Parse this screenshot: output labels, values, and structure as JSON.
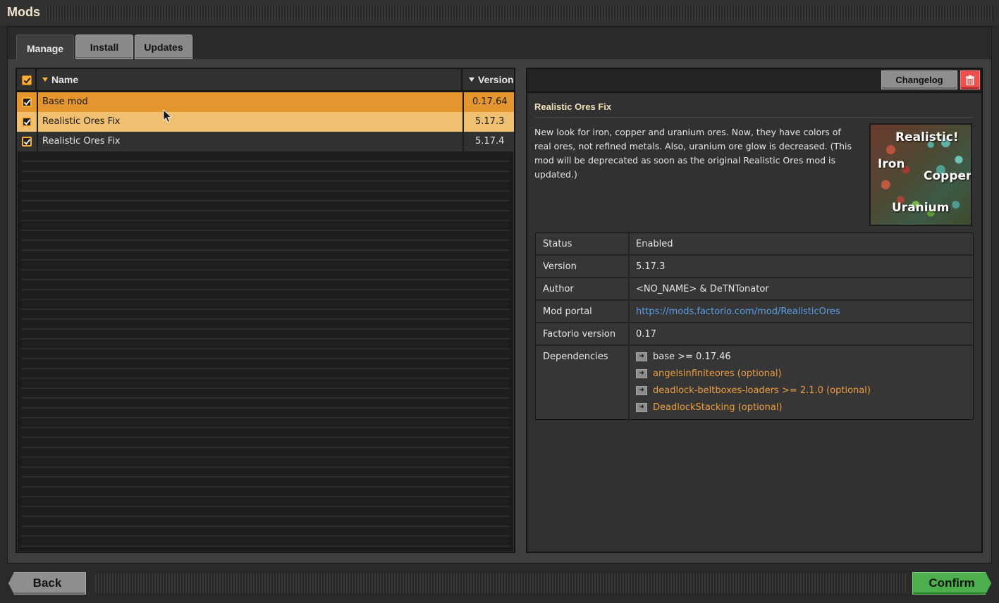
{
  "window": {
    "title": "Mods"
  },
  "tabs": [
    {
      "label": "Manage",
      "active": true
    },
    {
      "label": "Install",
      "active": false
    },
    {
      "label": "Updates",
      "active": false
    }
  ],
  "mod_list": {
    "header": {
      "name_label": "Name",
      "version_label": "Version",
      "all_checked": true
    },
    "rows": [
      {
        "name": "Base mod",
        "version": "0.17.64",
        "enabled": true,
        "state": "selected"
      },
      {
        "name": "Realistic Ores Fix",
        "version": "5.17.3",
        "enabled": true,
        "state": "highlighted"
      },
      {
        "name": "Realistic Ores Fix",
        "version": "5.17.4",
        "enabled": true,
        "state": "normal"
      }
    ]
  },
  "detail": {
    "changelog_label": "Changelog",
    "delete_icon": "trash-icon",
    "title": "Realistic Ores Fix",
    "description": "New look for iron, copper and uranium ores. Now, they have colors of real ores, not refined metals. Also, uranium ore glow is decreased. (This mod will be deprecated as soon as the original Realistic Ores mod is updated.)",
    "thumbnail_words": {
      "top": "Realistic!",
      "left": "Iron",
      "right": "Copper",
      "bottom": "Uranium"
    },
    "info": {
      "status": {
        "key": "Status",
        "value": "Enabled"
      },
      "version": {
        "key": "Version",
        "value": "5.17.3"
      },
      "author": {
        "key": "Author",
        "value": "<NO_NAME> & DeTNTonator"
      },
      "mod_portal": {
        "key": "Mod portal",
        "value": "https://mods.factorio.com/mod/RealisticOres"
      },
      "factorio_version": {
        "key": "Factorio version",
        "value": "0.17"
      },
      "dependencies": {
        "key": "Dependencies",
        "items": [
          {
            "text": "base >= 0.17.46",
            "optional": false
          },
          {
            "text": "angelsinfiniteores (optional)",
            "optional": true
          },
          {
            "text": "deadlock-beltboxes-loaders >= 2.1.0 (optional)",
            "optional": true
          },
          {
            "text": "DeadlockStacking (optional)",
            "optional": true
          }
        ]
      }
    }
  },
  "footer": {
    "back_label": "Back",
    "confirm_label": "Confirm"
  },
  "colors": {
    "accent_orange": "#e5952d",
    "highlight_orange": "#f0bf6f",
    "link_blue": "#5b9ee6",
    "optional_dep": "#ef9e3f",
    "confirm_green": "#4cae4c",
    "delete_red": "#ee4f4f"
  }
}
